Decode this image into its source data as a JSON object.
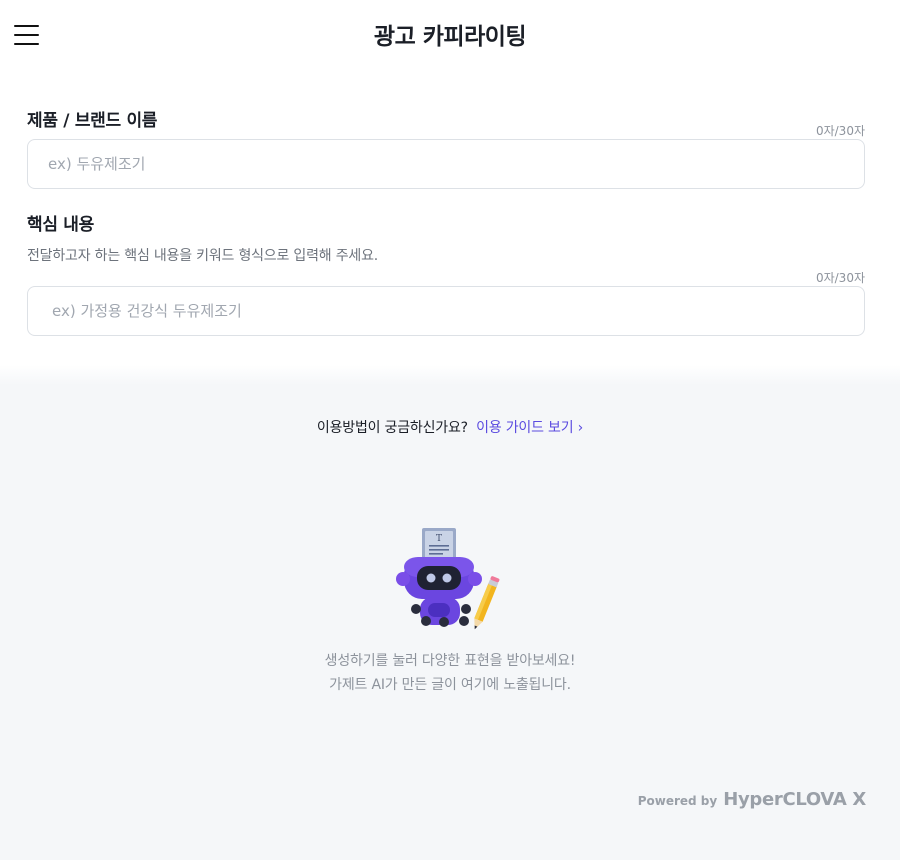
{
  "header": {
    "title": "광고 카피라이팅"
  },
  "form": {
    "product": {
      "label": "제품 / 브랜드 이름",
      "counter": "0자/30자",
      "placeholder": "ex) 두유제조기",
      "value": ""
    },
    "core": {
      "label": "핵심 내용",
      "helper": "전달하고자 하는 핵심 내용을 키워드 형식으로 입력해 주세요.",
      "counter": "0자/30자",
      "placeholder": "ex) 가정용 건강식 두유제조기",
      "value": ""
    }
  },
  "guide": {
    "question": "이용방법이 궁금하신가요?",
    "link": "이용 가이드 보기"
  },
  "empty_state": {
    "line1": "생성하기를 눌러 다양한 표현을 받아보세요!",
    "line2": "가제트 AI가 만든 글이 여기에 노출됩니다.",
    "illustration": "robot-writer-icon"
  },
  "footer": {
    "powered_by": "Powered by",
    "brand": "HyperCLOVA X"
  },
  "colors": {
    "accent": "#5b4be0",
    "background": "#f5f7f9",
    "border": "#dde1e6"
  }
}
